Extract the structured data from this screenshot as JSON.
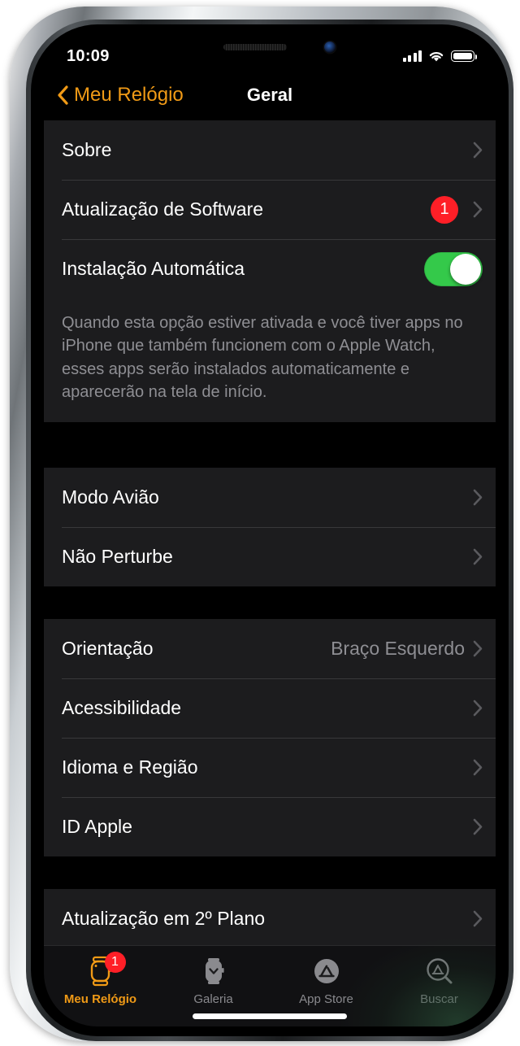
{
  "status_bar": {
    "time": "10:09",
    "cellular_icon": "signal-bars-icon",
    "wifi_icon": "wifi-icon",
    "battery_icon": "battery-full-icon"
  },
  "nav": {
    "back_label": "Meu Relógio",
    "back_icon": "chevron-left-icon",
    "title": "Geral"
  },
  "sections": [
    {
      "rows": [
        {
          "label": "Sobre",
          "accessory": "chevron",
          "value": ""
        },
        {
          "label": "Atualização de Software",
          "accessory": "badge-chevron",
          "badge": "1",
          "value": ""
        },
        {
          "label": "Instalação Automática",
          "accessory": "toggle",
          "toggle_on": true,
          "value": ""
        }
      ],
      "footnote": "Quando esta opção estiver ativada e você tiver apps no iPhone que também funcionem com o Apple Watch, esses apps serão instalados automaticamente e aparecerão na tela de início."
    },
    {
      "rows": [
        {
          "label": "Modo Avião",
          "accessory": "chevron",
          "value": ""
        },
        {
          "label": "Não Perturbe",
          "accessory": "chevron",
          "value": ""
        }
      ],
      "footnote": ""
    },
    {
      "rows": [
        {
          "label": "Orientação",
          "accessory": "chevron",
          "value": "Braço Esquerdo"
        },
        {
          "label": "Acessibilidade",
          "accessory": "chevron",
          "value": ""
        },
        {
          "label": "Idioma e Região",
          "accessory": "chevron",
          "value": ""
        },
        {
          "label": "ID Apple",
          "accessory": "chevron",
          "value": ""
        }
      ],
      "footnote": ""
    },
    {
      "rows": [
        {
          "label": "Atualização em 2º Plano",
          "accessory": "chevron",
          "value": ""
        }
      ],
      "footnote": ""
    }
  ],
  "tabs": [
    {
      "label": "Meu Relógio",
      "icon": "watch-icon",
      "active": true,
      "badge": "1"
    },
    {
      "label": "Galeria",
      "icon": "watch-face-gallery-icon",
      "active": false,
      "badge": ""
    },
    {
      "label": "App Store",
      "icon": "app-store-icon",
      "active": false,
      "badge": ""
    },
    {
      "label": "Buscar",
      "icon": "app-store-search-icon",
      "active": false,
      "badge": ""
    }
  ],
  "colors": {
    "accent": "#f09a16",
    "badge_red": "#ff1f27",
    "toggle_green": "#34c94a",
    "row_bg": "#1c1c1e",
    "secondary_text": "#8e8e93"
  }
}
